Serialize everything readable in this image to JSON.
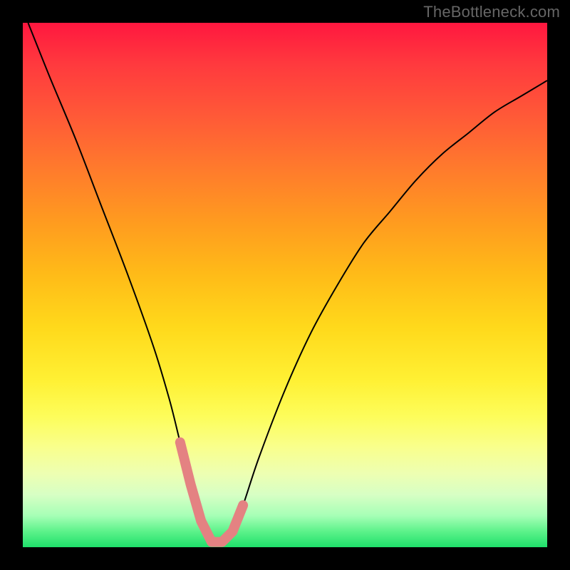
{
  "attribution": "TheBottleneck.com",
  "chart_data": {
    "type": "line",
    "title": "",
    "xlabel": "",
    "ylabel": "",
    "xlim": [
      0,
      100
    ],
    "ylim": [
      0,
      100
    ],
    "background_gradient": {
      "top": "#ff173f",
      "bottom": "#1fe06b",
      "stops": [
        "red",
        "orange",
        "yellow",
        "green"
      ]
    },
    "series": [
      {
        "name": "bottleneck-curve",
        "description": "V-shaped curve; y≈0 is optimal (green), y≈100 is worst (red). Minimum near x≈36.",
        "x": [
          1,
          5,
          10,
          15,
          20,
          25,
          28,
          30,
          32,
          34,
          36,
          38,
          40,
          42,
          45,
          50,
          55,
          60,
          65,
          70,
          75,
          80,
          85,
          90,
          95,
          100
        ],
        "values": [
          100,
          90,
          78,
          65,
          52,
          38,
          28,
          20,
          12,
          5,
          1,
          1,
          3,
          8,
          17,
          30,
          41,
          50,
          58,
          64,
          70,
          75,
          79,
          83,
          86,
          89
        ]
      }
    ],
    "highlight": {
      "name": "optimal-range-marker",
      "color": "#e48282",
      "x_range": [
        30,
        42
      ],
      "points": [
        {
          "x": 30,
          "y": 20
        },
        {
          "x": 32,
          "y": 12
        },
        {
          "x": 34,
          "y": 5
        },
        {
          "x": 36,
          "y": 1
        },
        {
          "x": 38,
          "y": 1
        },
        {
          "x": 40,
          "y": 3
        },
        {
          "x": 42,
          "y": 8
        }
      ]
    }
  }
}
